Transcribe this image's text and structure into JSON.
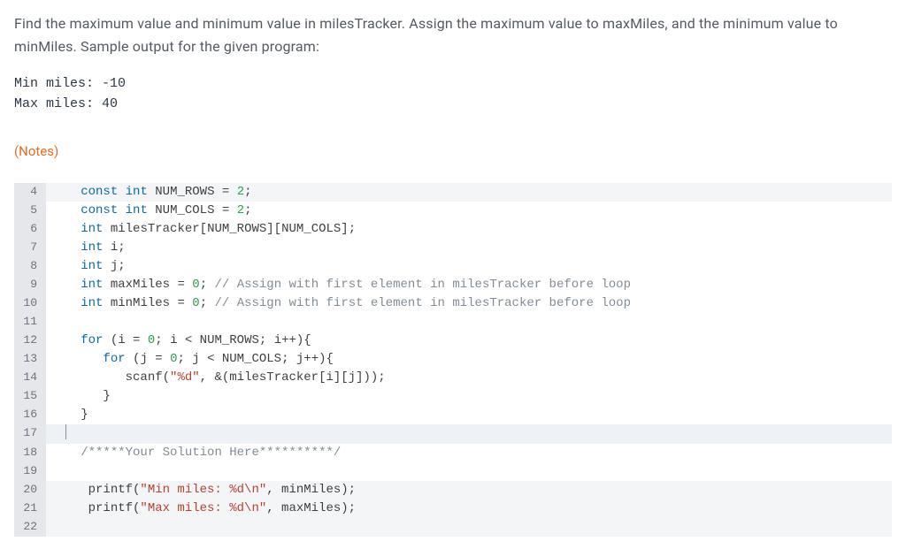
{
  "problem": {
    "text": "Find the maximum value and minimum value in milesTracker. Assign the maximum value to maxMiles, and the minimum value to minMiles. Sample output for the given program:"
  },
  "sample_output": {
    "line1": "Min miles: -10",
    "line2": "Max miles: 40"
  },
  "notes_label": "(Notes)",
  "code_tokens": {
    "const": "const",
    "int": "int",
    "for": "for",
    "NUM_ROWS": "NUM_ROWS",
    "NUM_COLS": "NUM_COLS",
    "eq": " = ",
    "two": "2",
    "zero": "0",
    "semi": ";",
    "milesTracker": "milesTracker",
    "i": "i",
    "j": "j",
    "maxMiles": "maxMiles",
    "minMiles": "minMiles",
    "cmt_assign": " // Assign with first element in milesTracker before loop",
    "for_i_head_a": " (i = ",
    "for_i_head_b": "; i < NUM_ROWS; i++){",
    "for_j_head_a": " (j = ",
    "for_j_head_b": "; j < NUM_COLS; j++){",
    "scanf": "scanf(",
    "fmt_d": "\"%d\"",
    "scanf_rest": ", &(milesTracker[i][j]));",
    "close_inner": "      }",
    "close_outer": "   }",
    "your_solution": "/*****Your Solution Here**********/",
    "printf1_a": "printf(",
    "printf1_str": "\"Min miles: %d\\n\"",
    "printf1_b": ", minMiles);",
    "printf2_a": "printf(",
    "printf2_str": "\"Max miles: %d\\n\"",
    "printf2_b": ", maxMiles);",
    "decl_arr_rest": "[NUM_ROWS][NUM_COLS];"
  },
  "line_numbers": {
    "l4": "4",
    "l5": "5",
    "l6": "6",
    "l7": "7",
    "l8": "8",
    "l9": "9",
    "l10": "10",
    "l11": "11",
    "l12": "12",
    "l13": "13",
    "l14": "14",
    "l15": "15",
    "l16": "16",
    "l17": "17",
    "l18": "18",
    "l19": "19",
    "l20": "20",
    "l21": "21",
    "l22": "22"
  }
}
